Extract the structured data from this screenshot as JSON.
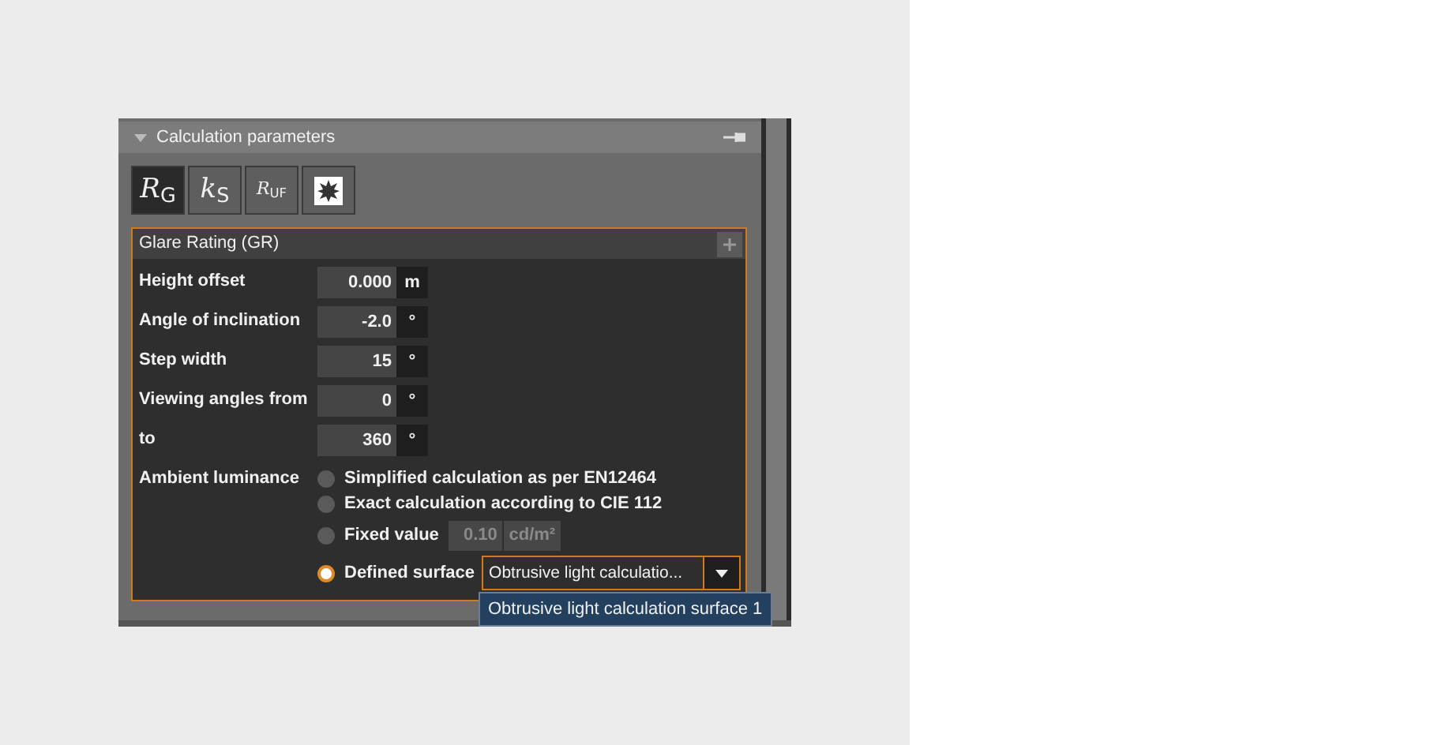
{
  "panel": {
    "title": "Calculation parameters"
  },
  "tabs": [
    {
      "label": "R$_{G}$",
      "kind": "text",
      "selected": true
    },
    {
      "label": "k$_{S}$",
      "kind": "text",
      "selected": false
    },
    {
      "label": "R$_{UF}$",
      "kind": "small",
      "selected": false
    },
    {
      "kind": "icon",
      "selected": false
    }
  ],
  "section": {
    "title": "Glare Rating (GR)"
  },
  "fields": [
    {
      "label": "Height offset",
      "value": "0.000",
      "unit": "m"
    },
    {
      "label": "Angle of inclination",
      "value": "-2.0",
      "unit": "°"
    },
    {
      "label": "Step width",
      "value": "15",
      "unit": "°"
    },
    {
      "label": "Viewing angles from",
      "value": "0",
      "unit": "°"
    },
    {
      "label": "to",
      "value": "360",
      "unit": "°"
    }
  ],
  "ambient": {
    "label": "Ambient luminance",
    "options": [
      {
        "label": "Simplified calculation as per EN12464",
        "kind": "plain",
        "selected": false
      },
      {
        "label": "Exact calculation according to CIE 112",
        "kind": "plain",
        "selected": false
      },
      {
        "label": "Fixed value",
        "kind": "value",
        "value": "0.10",
        "unit": "cd/m²",
        "disabled": true,
        "selected": false
      },
      {
        "label": "Defined surface",
        "kind": "select",
        "value": "Obtrusive light calculatio...",
        "selected": true
      }
    ]
  },
  "dropdown_list": [
    "Obtrusive light calculation surface 1"
  ]
}
